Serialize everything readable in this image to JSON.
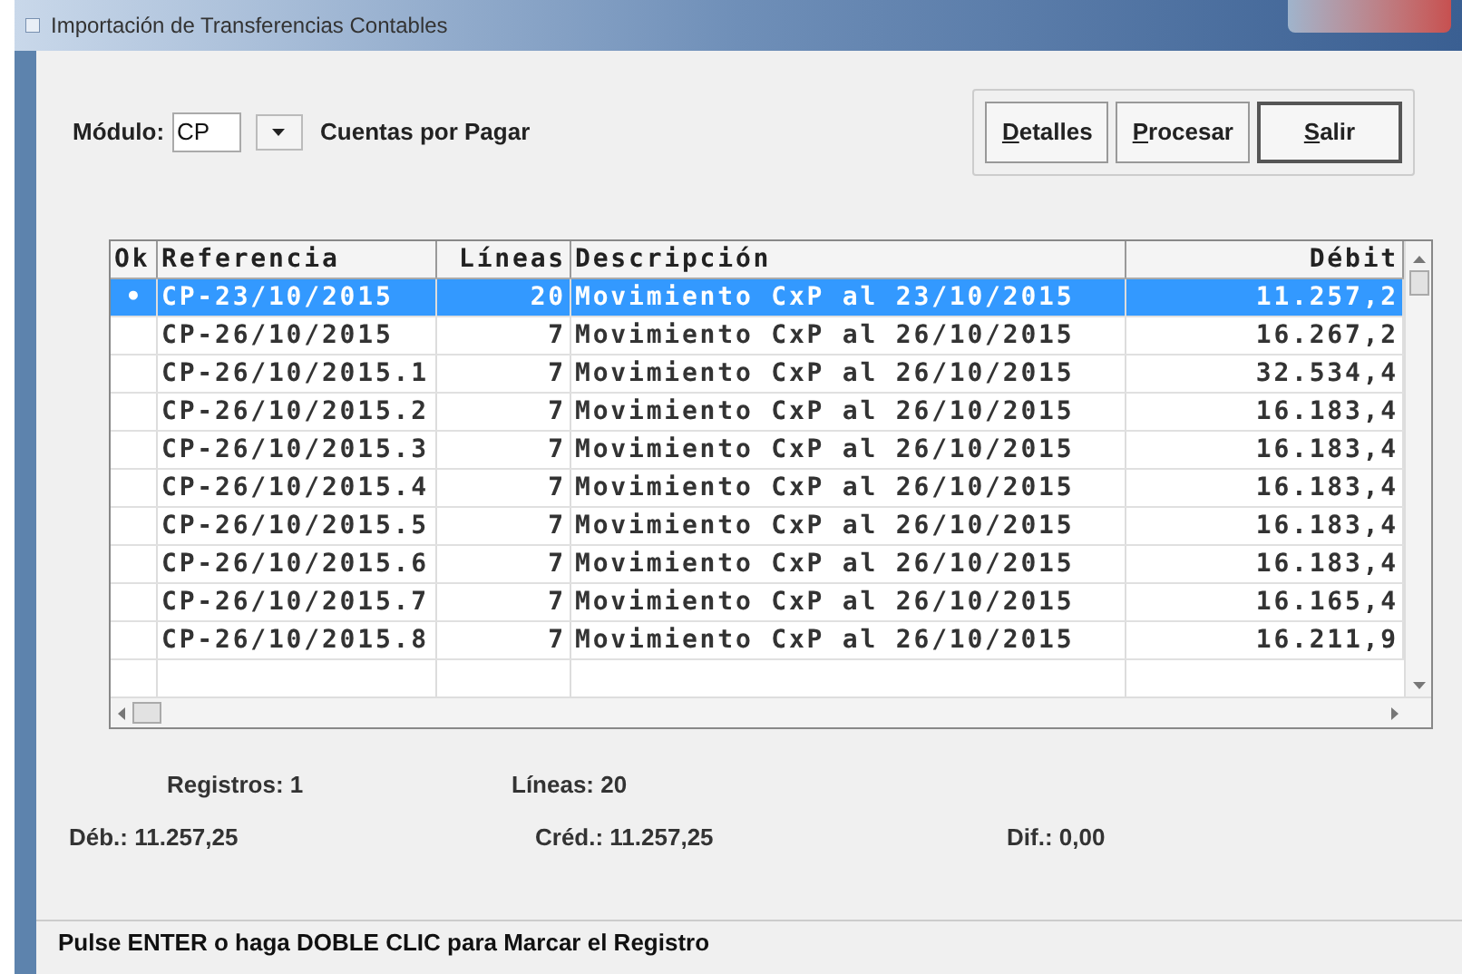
{
  "window": {
    "title": "Importación de Transferencias Contables"
  },
  "module": {
    "label": "Módulo:",
    "value": "CP",
    "name": "Cuentas por Pagar"
  },
  "buttons": [
    {
      "label": "Detalles",
      "access_key_underlined": true,
      "default": false
    },
    {
      "label": "Procesar",
      "access_key_underlined": true,
      "default": false
    },
    {
      "label": "Salir",
      "access_key_underlined": true,
      "default": true
    }
  ],
  "table": {
    "columns": [
      "Ok",
      "Referencia",
      "Líneas",
      "Descripción",
      "Débit"
    ],
    "rows": [
      {
        "selected": true,
        "cells": [
          "•",
          "CP-23/10/2015",
          "20",
          "Movimiento CxP al 23/10/2015",
          "11.257,2"
        ]
      },
      {
        "selected": false,
        "cells": [
          "",
          "CP-26/10/2015",
          "7",
          "Movimiento CxP al 26/10/2015",
          "16.267,2"
        ]
      },
      {
        "selected": false,
        "cells": [
          "",
          "CP-26/10/2015.1",
          "7",
          "Movimiento CxP al 26/10/2015",
          "32.534,4"
        ]
      },
      {
        "selected": false,
        "cells": [
          "",
          "CP-26/10/2015.2",
          "7",
          "Movimiento CxP al 26/10/2015",
          "16.183,4"
        ]
      },
      {
        "selected": false,
        "cells": [
          "",
          "CP-26/10/2015.3",
          "7",
          "Movimiento CxP al 26/10/2015",
          "16.183,4"
        ]
      },
      {
        "selected": false,
        "cells": [
          "",
          "CP-26/10/2015.4",
          "7",
          "Movimiento CxP al 26/10/2015",
          "16.183,4"
        ]
      },
      {
        "selected": false,
        "cells": [
          "",
          "CP-26/10/2015.5",
          "7",
          "Movimiento CxP al 26/10/2015",
          "16.183,4"
        ]
      },
      {
        "selected": false,
        "cells": [
          "",
          "CP-26/10/2015.6",
          "7",
          "Movimiento CxP al 26/10/2015",
          "16.183,4"
        ]
      },
      {
        "selected": false,
        "cells": [
          "",
          "CP-26/10/2015.7",
          "7",
          "Movimiento CxP al 26/10/2015",
          "16.165,4"
        ]
      },
      {
        "selected": false,
        "cells": [
          "",
          "CP-26/10/2015.8",
          "7",
          "Movimiento CxP al 26/10/2015",
          "16.211,9"
        ]
      }
    ]
  },
  "summary": [
    {
      "label": "Registros: 1"
    },
    {
      "label": "Líneas: 20"
    }
  ],
  "totals": [
    {
      "label": "Déb.: 11.257,25"
    },
    {
      "label": "Créd.: 11.257,25"
    },
    {
      "label": "Dif.: 0,00"
    }
  ],
  "status_bar": "Pulse ENTER o haga DOBLE CLIC para Marcar el Registro"
}
